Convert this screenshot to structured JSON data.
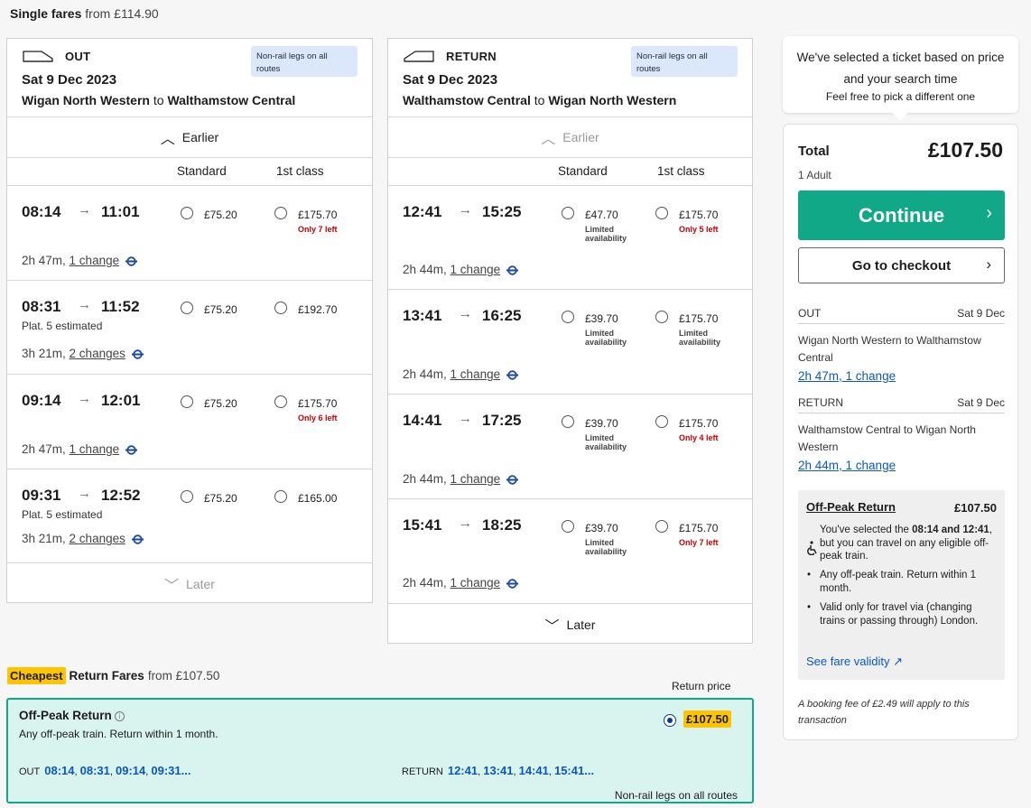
{
  "header": {
    "label": "Single fares",
    "from": "from £114.90"
  },
  "out": {
    "direction": "OUT",
    "date": "Sat 9 Dec 2023",
    "origin": "Wigan North Western",
    "to": "to",
    "destination": "Walthamstow Central",
    "badge": "Non-rail legs on all routes",
    "earlier": "Earlier",
    "col_standard": "Standard",
    "col_first": "1st class",
    "later": "Later",
    "rows": [
      {
        "dep": "08:14",
        "arr": "11:01",
        "plat": "",
        "dur": "2h 47m,",
        "changes": "1 change",
        "std": "£75.20",
        "std_note": "",
        "first": "£175.70",
        "first_note": "Only 7 left"
      },
      {
        "dep": "08:31",
        "arr": "11:52",
        "plat": "Plat. 5 estimated",
        "dur": "3h 21m,",
        "changes": "2 changes",
        "std": "£75.20",
        "std_note": "",
        "first": "£192.70",
        "first_note": ""
      },
      {
        "dep": "09:14",
        "arr": "12:01",
        "plat": "",
        "dur": "2h 47m,",
        "changes": "1 change",
        "std": "£75.20",
        "std_note": "",
        "first": "£175.70",
        "first_note": "Only 6 left"
      },
      {
        "dep": "09:31",
        "arr": "12:52",
        "plat": "Plat. 5 estimated",
        "dur": "3h 21m,",
        "changes": "2 changes",
        "std": "£75.20",
        "std_note": "",
        "first": "£165.00",
        "first_note": ""
      }
    ]
  },
  "ret": {
    "direction": "RETURN",
    "date": "Sat 9 Dec 2023",
    "origin": "Walthamstow Central",
    "to": "to",
    "destination": "Wigan North Western",
    "badge": "Non-rail legs on all routes",
    "earlier": "Earlier",
    "col_standard": "Standard",
    "col_first": "1st class",
    "later": "Later",
    "rows": [
      {
        "dep": "12:41",
        "arr": "15:25",
        "dur": "2h 44m,",
        "changes": "1 change",
        "std": "£47.70",
        "std_note1": "Limited",
        "std_note2": "availability",
        "first": "£175.70",
        "first_note1": "Only 5 left",
        "first_note2": ""
      },
      {
        "dep": "13:41",
        "arr": "16:25",
        "dur": "2h 44m,",
        "changes": "1 change",
        "std": "£39.70",
        "std_note1": "Limited",
        "std_note2": "availability",
        "first": "£175.70",
        "first_note1": "Limited",
        "first_note2": "availability"
      },
      {
        "dep": "14:41",
        "arr": "17:25",
        "dur": "2h 44m,",
        "changes": "1 change",
        "std": "£39.70",
        "std_note1": "Limited",
        "std_note2": "availability",
        "first": "£175.70",
        "first_note1": "Only 4 left",
        "first_note2": ""
      },
      {
        "dep": "15:41",
        "arr": "18:25",
        "dur": "2h 44m,",
        "changes": "1 change",
        "std": "£39.70",
        "std_note1": "Limited",
        "std_note2": "availability",
        "first": "£175.70",
        "first_note1": "Only 7 left",
        "first_note2": ""
      }
    ]
  },
  "tip": {
    "line1": "We've selected a ticket based on price",
    "line2": "and your search time",
    "line3": "Feel free to pick a different one"
  },
  "summary": {
    "total_label": "Total",
    "total_price": "£107.50",
    "passengers": "1 Adult",
    "continue": "Continue",
    "checkout": "Go to checkout",
    "out_label": "OUT",
    "out_date": "Sat 9 Dec",
    "out_route": "Wigan North Western to Walthamstow Central",
    "out_link": "2h 47m, 1 change",
    "ret_label": "RETURN",
    "ret_date": "Sat 9 Dec",
    "ret_route": "Walthamstow Central to Wigan North Western",
    "ret_link": "2h 44m, 1 change",
    "fare_name": "Off-Peak Return",
    "fare_price": "£107.50",
    "fare_info_pre": "You've selected the ",
    "fare_info_times": "08:14 and 12:41",
    "fare_info_post": ", but you can travel on any eligible off-peak train.",
    "bullet1": "Any off-peak train. Return within 1 month.",
    "bullet2": "Valid only for travel via (changing trains or passing through) London.",
    "validity": "See fare validity",
    "booking_fee": "A booking fee of £2.49 will apply to this transaction"
  },
  "cheapest": {
    "tag": "Cheapest",
    "label": "Return Fares",
    "from": "from £107.50",
    "return_price_label": "Return price",
    "fare_name": "Off-Peak Return",
    "fare_desc": "Any off-peak train. Return within 1 month.",
    "price": "£107.50",
    "out_label": "OUT",
    "out_times": [
      "08:14",
      "08:31",
      "09:14",
      "09:31"
    ],
    "ret_label": "RETURN",
    "ret_times": [
      "12:41",
      "13:41",
      "14:41",
      "15:41"
    ],
    "ellipsis": "...",
    "non_rail": "Non-rail legs on all routes"
  },
  "colors": {
    "accent": "#10a887",
    "highlight": "#ffc400",
    "link": "#0a58c2",
    "warning": "#c40000"
  }
}
